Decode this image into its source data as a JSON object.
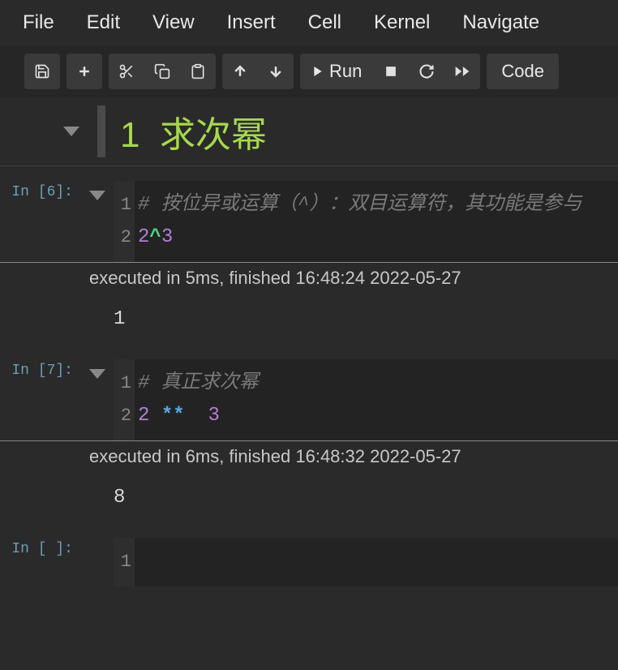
{
  "menu": {
    "file": "File",
    "edit": "Edit",
    "view": "View",
    "insert": "Insert",
    "cell": "Cell",
    "kernel": "Kernel",
    "navigate": "Navigate"
  },
  "toolbar": {
    "run": "Run",
    "celltype": "Code"
  },
  "heading": {
    "number": "1",
    "title": "求次幂"
  },
  "cells": [
    {
      "prompt": "In [6]:",
      "gutter": [
        "1",
        "2"
      ],
      "line1_comment": "# 按位异或运算（^）：双目运算符，其功能是参与",
      "line2_a": "2",
      "line2_op": "^",
      "line2_b": "3",
      "meta": "executed in 5ms, finished 16:48:24 2022-05-27",
      "output": "1"
    },
    {
      "prompt": "In [7]:",
      "gutter": [
        "1",
        "2"
      ],
      "line1_comment": "# 真正求次幂",
      "line2_a": "2",
      "line2_op": "**",
      "line2_b": "3",
      "meta": "executed in 6ms, finished 16:48:32 2022-05-27",
      "output": "8"
    },
    {
      "prompt": "In [ ]:",
      "gutter": [
        "1"
      ]
    }
  ]
}
